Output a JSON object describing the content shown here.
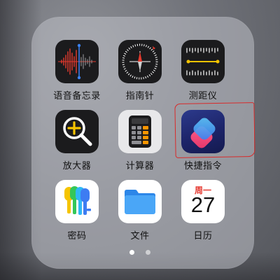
{
  "folder": {
    "apps": [
      {
        "label": "语音备忘录",
        "icon": "voice-memos-icon"
      },
      {
        "label": "指南针",
        "icon": "compass-icon"
      },
      {
        "label": "测距仪",
        "icon": "measure-icon"
      },
      {
        "label": "放大器",
        "icon": "magnifier-icon"
      },
      {
        "label": "计算器",
        "icon": "calculator-icon"
      },
      {
        "label": "快捷指令",
        "icon": "shortcuts-icon"
      },
      {
        "label": "密码",
        "icon": "passwords-icon"
      },
      {
        "label": "文件",
        "icon": "files-icon"
      },
      {
        "label": "日历",
        "icon": "calendar-icon"
      }
    ],
    "calendar": {
      "weekday": "周一",
      "date": "27"
    },
    "page_count": 2,
    "current_page": 1
  },
  "annotation": {
    "highlighted_app": "快捷指令",
    "color": "#d92a2a"
  }
}
